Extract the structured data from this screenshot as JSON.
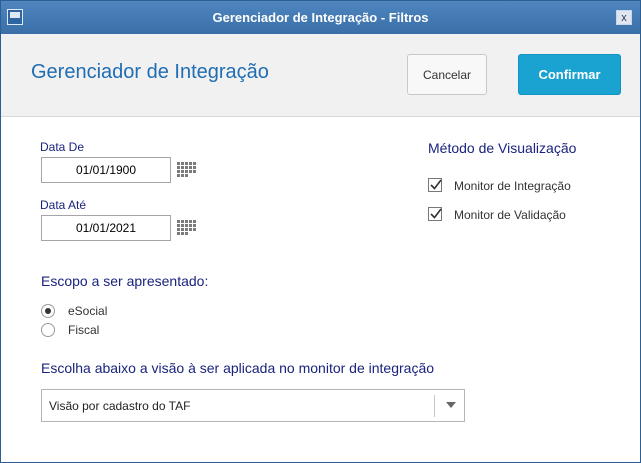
{
  "window": {
    "title": "Gerenciador de Integração - Filtros",
    "close_label": "x"
  },
  "header": {
    "title": "Gerenciador de Integração",
    "cancel_label": "Cancelar",
    "confirm_label": "Confirmar"
  },
  "dates": {
    "from_label": "Data De",
    "from_value": "01/01/1900",
    "to_label": "Data Até",
    "to_value": "01/01/2021"
  },
  "view_method": {
    "title": "Método de Visualização",
    "options": [
      {
        "label": "Monitor de Integração",
        "checked": true
      },
      {
        "label": "Monitor de Validação",
        "checked": true
      }
    ]
  },
  "scope": {
    "title": "Escopo a ser apresentado:",
    "options": [
      {
        "label": "eSocial",
        "selected": true
      },
      {
        "label": "Fiscal",
        "selected": false
      }
    ]
  },
  "view_select": {
    "title": "Escolha abaixo a visão à ser aplicada no monitor de integração",
    "value": "Visão por cadastro do TAF"
  },
  "colors": {
    "accent": "#1aa3d1",
    "title_blue": "#1f6db3",
    "label_navy": "#1a237e",
    "titlebar": "#3a6fa8"
  }
}
